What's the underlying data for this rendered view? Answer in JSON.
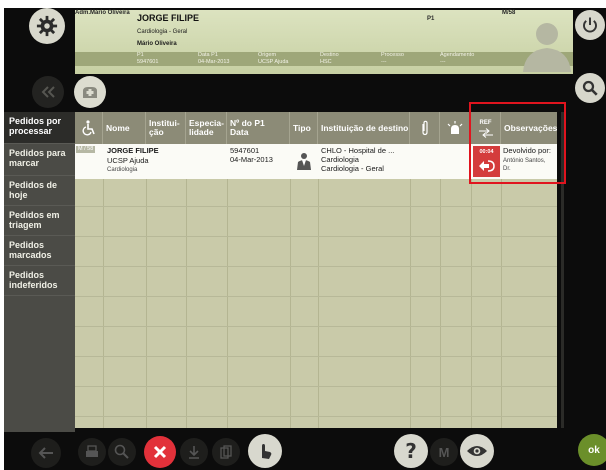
{
  "header": {
    "admin": "Adm.Mário Oliveira",
    "patient_name": "JORGE FILIPE",
    "specialty": "Cardiologia - Geral",
    "doctor": "Mário Oliveira",
    "p1_tag": "P1",
    "code_tag": "M/58",
    "fields": [
      {
        "label": "P1",
        "value": "5947601"
      },
      {
        "label": "Data P1",
        "value": "04-Mar-2013"
      },
      {
        "label": "Origem",
        "value": "UCSP Ajuda"
      },
      {
        "label": "Destino",
        "value": "HSC"
      },
      {
        "label": "Processo",
        "value": "---"
      },
      {
        "label": "Agendamento",
        "value": "---"
      }
    ]
  },
  "sidebar": {
    "items": [
      {
        "label": "Pedidos por processar",
        "active": true
      },
      {
        "label": "Pedidos para marcar",
        "active": false
      },
      {
        "label": "Pedidos de hoje",
        "active": false
      },
      {
        "label": "Pedidos em triagem",
        "active": false
      },
      {
        "label": "Pedidos marcados",
        "active": false
      },
      {
        "label": "Pedidos indeferidos",
        "active": false
      }
    ]
  },
  "table": {
    "columns": {
      "nome": "Nome",
      "instituicao": "Institui-\nção",
      "especialidade": "Especia-\nlidade",
      "p1": "Nº do P1\nData",
      "tipo": "Tipo",
      "inst_destino": "Instituição de destino",
      "ref": "REF",
      "observacoes": "Observações"
    },
    "rows": [
      {
        "badge": "M / 58",
        "name": "JORGE FILIPE",
        "origin": "UCSP Ajuda",
        "specialty": "Cardiologia",
        "p1": "5947601",
        "date": "04-Mar-2013",
        "dest_line1": "CHLO - Hospital de ...",
        "dest_line2": "Cardiologia",
        "dest_line3": "Cardiologia - Geral",
        "ref_time": "00:04",
        "obs_line1": "Devolvido por:",
        "obs_line2": "António Santos,",
        "obs_line3": "Dr."
      }
    ]
  },
  "footer": {
    "ok_label": "ok"
  },
  "colors": {
    "accent_red": "#e0141e",
    "ref_red": "#d43c3c",
    "ok_green": "#6b8f2a"
  }
}
